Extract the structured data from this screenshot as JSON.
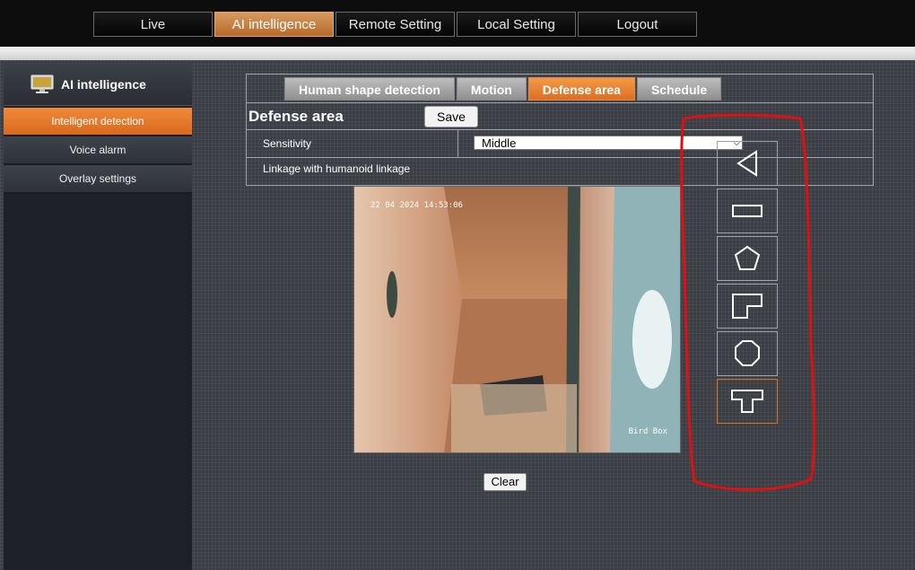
{
  "topnav": {
    "tabs": [
      {
        "label": "Live"
      },
      {
        "label": "AI intelligence"
      },
      {
        "label": "Remote Setting"
      },
      {
        "label": "Local Setting"
      },
      {
        "label": "Logout"
      }
    ],
    "active_index": 1
  },
  "sidebar": {
    "header": "AI intelligence",
    "header_icon": "monitor-icon",
    "items": [
      {
        "label": "Intelligent detection"
      },
      {
        "label": "Voice alarm"
      },
      {
        "label": "Overlay settings"
      }
    ],
    "active_index": 0
  },
  "panel": {
    "tabs": [
      {
        "label": "Human shape detection"
      },
      {
        "label": "Motion"
      },
      {
        "label": "Defense area"
      },
      {
        "label": "Schedule"
      }
    ],
    "active_index": 2,
    "title": "Defense area",
    "save_label": "Save",
    "sensitivity_label": "Sensitivity",
    "sensitivity_value": "Middle",
    "linkage_label": "Linkage with humanoid linkage"
  },
  "camera": {
    "timestamp": "22 04 2024 14:53:06",
    "name": "Bird Box"
  },
  "clear_label": "Clear",
  "shapes": [
    {
      "icon": "triangle-icon"
    },
    {
      "icon": "rectangle-icon"
    },
    {
      "icon": "pentagon-icon"
    },
    {
      "icon": "l-shape-icon"
    },
    {
      "icon": "octagon-icon"
    },
    {
      "icon": "t-shape-icon"
    }
  ],
  "colors": {
    "accent": "#e07a2a",
    "annotation": "#e01010"
  }
}
